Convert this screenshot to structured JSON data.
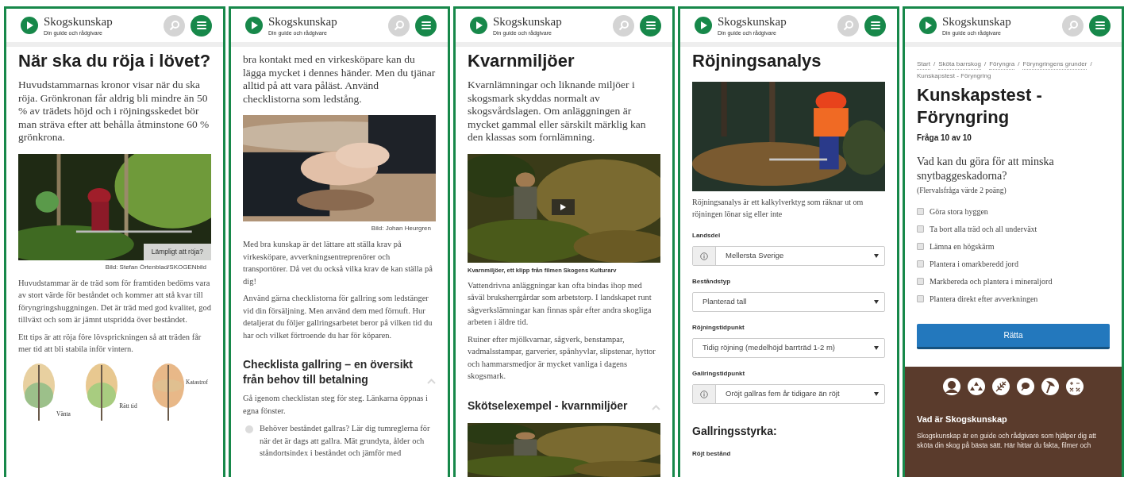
{
  "panels": [
    {
      "header": {
        "brand": "Skogskunskap",
        "tagline": "Din guide och rådgivare"
      },
      "blocks": [
        {
          "kind": "title",
          "text": "När ska du röja i lövet?"
        },
        {
          "kind": "lead",
          "text": "Huvudstammarnas kronor visar när du ska röja. Grönkronan får aldrig bli mindre än 50 % av trädets höjd och i röjningsskedet bör man sträva efter att behålla åtminstone 60 % grönkrona."
        },
        {
          "kind": "figure",
          "overlay": "Lämpligt att röja?",
          "credit": "Bild: Stefan Örtenblad/SKOGENbild"
        },
        {
          "kind": "paragraph",
          "text": "Huvudstammar är de träd som för framtiden bedöms vara av stort värde för beståndet och kommer att stå kvar till föryngringshuggningen. Det är träd med god kvalitet, god tillväxt och som är jämnt utspridda över beståndet."
        },
        {
          "kind": "paragraph",
          "text": "Ett tips är att röja före lövsprickningen så att träden får mer tid att bli stabila inför vintern."
        },
        {
          "kind": "trees",
          "labels": [
            "Vänta",
            "Rätt tid",
            "Katastrof"
          ]
        }
      ]
    },
    {
      "header": {
        "brand": "Skogskunskap",
        "tagline": "Din guide och rådgivare"
      },
      "blocks": [
        {
          "kind": "lead",
          "text": "bra kontakt med en virkesköpare kan du lägga mycket i dennes händer. Men du tjänar alltid på att vara påläst. Använd checklistorna som ledstång."
        },
        {
          "kind": "figure",
          "credit": "Bild: Johan Heurgren"
        },
        {
          "kind": "paragraph",
          "text": "Med bra kunskap är det lättare att ställa krav på virkesköpare, avverkningsentreprenörer och transportörer. Då vet du också vilka krav de kan ställa på dig!"
        },
        {
          "kind": "paragraph",
          "text": "Använd gärna checklistorna för gallring som ledstänger vid din försäljning. Men använd dem med förnuft. Hur detaljerat du följer gallringsarbetet beror på vilken tid du har och vilket förtroende du har för köparen."
        },
        {
          "kind": "section",
          "text": "Checklista gallring – en översikt från behov till betalning",
          "expanded": true
        },
        {
          "kind": "paragraph",
          "text": "Gå igenom checklistan steg för steg. Länkarna öppnas i egna fönster."
        },
        {
          "kind": "step",
          "text": "Behöver beståndet gallras? Lär dig tumreglerna för när det är dags att gallra. Mät grundyta, ålder och ståndortsindex i beståndet och jämför med",
          "done": false
        }
      ]
    },
    {
      "header": {
        "brand": "Skogskunskap",
        "tagline": "Din guide och rådgivare"
      },
      "blocks": [
        {
          "kind": "title",
          "text": "Kvarnmiljöer"
        },
        {
          "kind": "lead",
          "text": "Kvarnlämningar och liknande miljöer i skogsmark skyddas normalt av skogsvårdslagen. Om anläggningen är mycket gammal eller särskilt märklig kan den klassas som fornlämning."
        },
        {
          "kind": "video",
          "caption": "Kvarnmiljöer, ett klipp från filmen Skogens Kulturarv"
        },
        {
          "kind": "paragraph",
          "text": "Vattendrivna anläggningar kan ofta bindas ihop med såväl bruksherrgårdar som arbetstorp. I landskapet runt sågverkslämningar kan finnas spår efter andra skogliga arbeten i äldre tid."
        },
        {
          "kind": "paragraph",
          "text": "Ruiner efter mjölkvarnar, sågverk, benstampar, vadmalsstampar, garverier, spånhyvlar, slipstenar, hyttor och hammarsmedjor är mycket vanliga i dagens skogsmark."
        },
        {
          "kind": "section",
          "text": "Skötselexempel - kvarnmiljöer",
          "expanded": true
        },
        {
          "kind": "figure"
        }
      ]
    },
    {
      "header": {
        "brand": "Skogskunskap",
        "tagline": "Din guide och rådgivare"
      },
      "blocks": [
        {
          "kind": "title",
          "text": "Röjningsanalys"
        },
        {
          "kind": "figure"
        },
        {
          "kind": "note",
          "text": "Röjningsanalys är ett kalkylverktyg som räknar ut om röjningen lönar sig eller inte"
        },
        {
          "kind": "select",
          "label": "Landsdel",
          "value": "Mellersta Sverige",
          "info": true
        },
        {
          "kind": "select",
          "label": "Beståndstyp",
          "value": "Planterad tall",
          "info": false
        },
        {
          "kind": "select",
          "label": "Röjningstidpunkt",
          "value": "Tidig röjning (medelhöjd barrträd 1-2 m)",
          "info": false
        },
        {
          "kind": "select",
          "label": "Gallringstidpunkt",
          "value": "Oröjt gallras fem år tidigare än röjt",
          "info": true
        },
        {
          "kind": "subheading",
          "text": "Gallringsstyrka:"
        },
        {
          "kind": "label",
          "text": "Röjt bestånd"
        }
      ]
    },
    {
      "header": {
        "brand": "Skogskunskap",
        "tagline": "Din guide och rådgivare"
      },
      "blocks": [
        {
          "kind": "breadcrumb",
          "separator": "/",
          "items": [
            "Start",
            "Sköta barrskog",
            "Föryngra",
            "Föryngringens grunder",
            "Kunskapstest - Föryngring"
          ]
        },
        {
          "kind": "title",
          "text": "Kunskapstest - Föryngring"
        },
        {
          "kind": "progress",
          "text": "Fråga 10 av 10"
        },
        {
          "kind": "question",
          "text": "Vad kan du göra för att minska snytbaggeskadorna?",
          "note": "(Flervalsfråga värde 2 poäng)"
        },
        {
          "kind": "options",
          "items": [
            {
              "label": "Göra stora hyggen",
              "checked": false
            },
            {
              "label": "Ta bort alla träd och all underväxt",
              "checked": false
            },
            {
              "label": "Lämna en högskärm",
              "checked": false
            },
            {
              "label": "Plantera i omarkberedd jord",
              "checked": false
            },
            {
              "label": "Markbereda och plantera i mineraljord",
              "checked": false
            },
            {
              "label": "Plantera direkt efter avverkningen",
              "checked": false
            }
          ]
        },
        {
          "kind": "button",
          "text": "Rätta"
        },
        {
          "kind": "footer",
          "heading": "Vad är Skogskunskap",
          "text": "Skogskunskap är en guide och rådgivare som hjälper dig att sköta din skog på bästa sätt. Här hittar du fakta, filmer och"
        }
      ]
    }
  ]
}
